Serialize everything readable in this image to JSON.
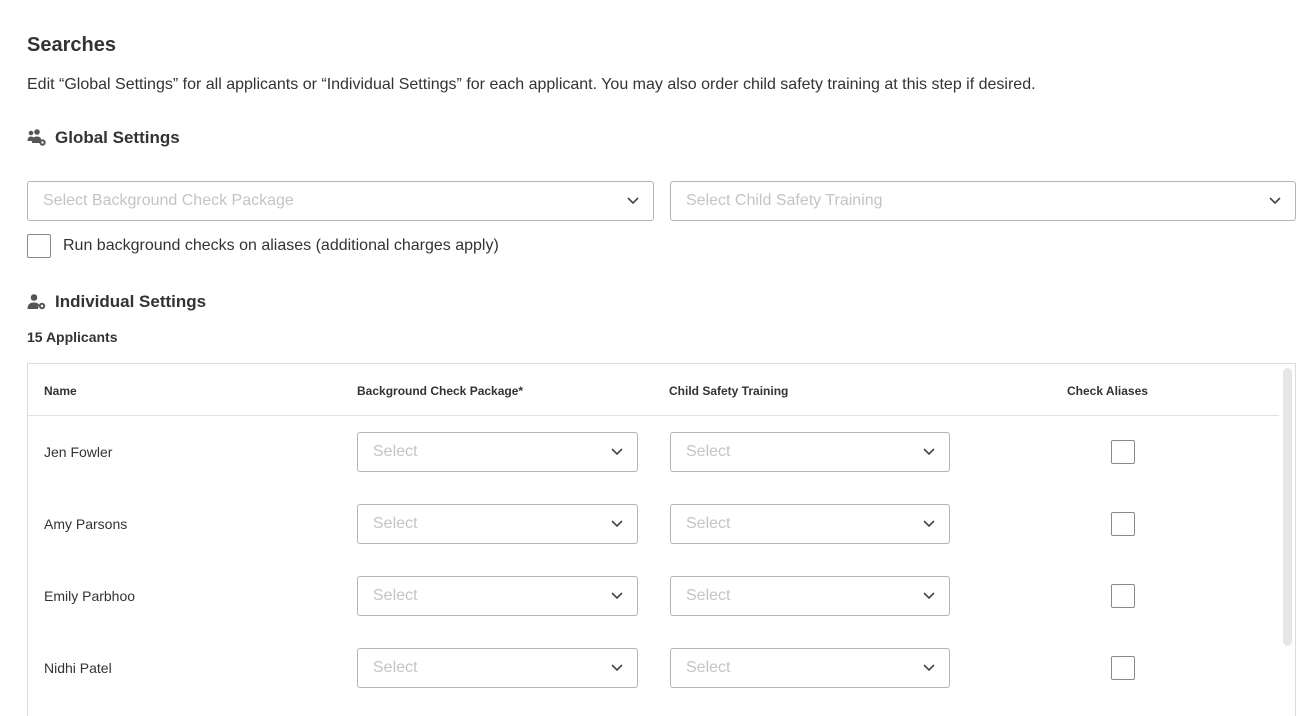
{
  "page": {
    "title": "Searches",
    "intro": "Edit “Global Settings” for all applicants or “Individual Settings” for each applicant. You may also order child safety training at this step if desired."
  },
  "global": {
    "heading": "Global Settings",
    "icon": "users-gear-icon",
    "package_placeholder": "Select Background Check Package",
    "training_placeholder": "Select Child Safety Training",
    "alias_label": "Run background checks on aliases (additional charges apply)",
    "alias_checked": false
  },
  "individual": {
    "heading": "Individual Settings",
    "icon": "user-gear-icon",
    "count_label": "15 Applicants",
    "columns": {
      "name": "Name",
      "package": "Background Check Package*",
      "training": "Child Safety Training",
      "aliases": "Check Aliases"
    },
    "rows": [
      {
        "name": "Jen Fowler",
        "package": "Select",
        "training": "Select",
        "aliases": false
      },
      {
        "name": "Amy Parsons",
        "package": "Select",
        "training": "Select",
        "aliases": false
      },
      {
        "name": "Emily Parbhoo",
        "package": "Select",
        "training": "Select",
        "aliases": false
      },
      {
        "name": "Nidhi Patel",
        "package": "Select",
        "training": "Select",
        "aliases": false
      }
    ]
  },
  "colors": {
    "text": "#333333",
    "placeholder": "#c4c4c4",
    "border": "#b5b5b5"
  }
}
